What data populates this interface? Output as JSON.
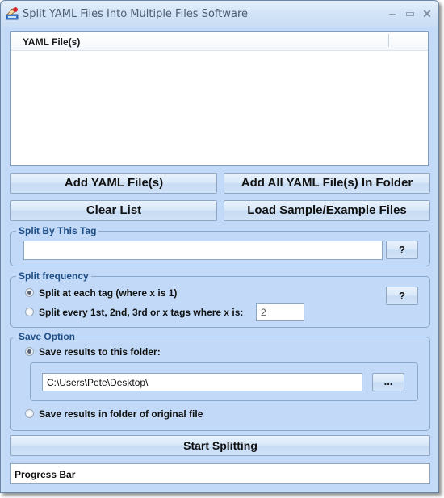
{
  "window": {
    "title": "Split YAML Files Into Multiple Files Software",
    "controls": {
      "minimize": "–",
      "maximize": "▭",
      "close": "✕"
    }
  },
  "file_list": {
    "columns": [
      "YAML File(s)"
    ],
    "rows": []
  },
  "buttons": {
    "add_files": "Add YAML File(s)",
    "add_folder": "Add All YAML File(s) In Folder",
    "clear_list": "Clear List",
    "load_sample": "Load Sample/Example Files",
    "start": "Start Splitting",
    "help": "?",
    "browse": "..."
  },
  "split_tag": {
    "label": "Split By This Tag",
    "value": ""
  },
  "split_frequency": {
    "label": "Split frequency",
    "options": [
      {
        "label": "Split at each tag (where x is 1)",
        "checked": true
      },
      {
        "label": "Split every 1st, 2nd, 3rd or x tags where x is:",
        "checked": false
      }
    ],
    "x_value": "2"
  },
  "save_option": {
    "label": "Save Option",
    "options": [
      {
        "label": "Save results to this folder:",
        "checked": true
      },
      {
        "label": "Save results in folder of original file",
        "checked": false
      }
    ],
    "folder_path": "C:\\Users\\Pete\\Desktop\\"
  },
  "progress": {
    "label": "Progress Bar"
  }
}
